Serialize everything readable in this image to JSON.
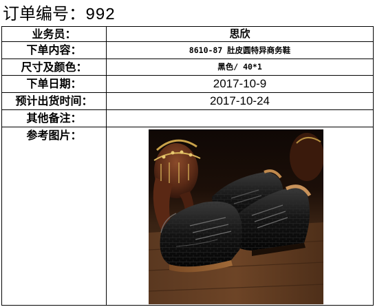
{
  "order": {
    "title_prefix": "订单编号：",
    "number": "992"
  },
  "fields": {
    "salesperson": {
      "label": "业务员：",
      "value": "思欣"
    },
    "content": {
      "label": "下单内容：",
      "value": "8610-87 肚皮圆特异商务鞋"
    },
    "size_color": {
      "label": "尺寸及颜色：",
      "value": "黑色/ 40*1"
    },
    "order_date": {
      "label": "下单日期：",
      "value": "2017-10-9"
    },
    "ship_date": {
      "label": "预计出货时间：",
      "value": "2017-10-24"
    },
    "remarks": {
      "label": "其他备注：",
      "value": ""
    },
    "reference": {
      "label": "参考图片："
    }
  }
}
